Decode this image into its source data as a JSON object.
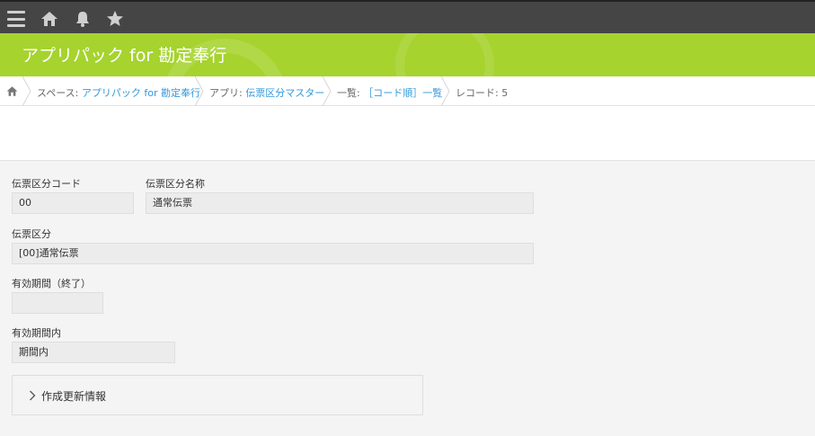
{
  "header": {
    "app_title": "アプリパック for 勘定奉行",
    "accent_color": "#a6d32e",
    "topbar_color": "#454545",
    "icons": [
      "menu-icon",
      "home-icon",
      "bell-icon",
      "star-icon"
    ]
  },
  "breadcrumb": {
    "space_prefix": "スペース: ",
    "space_link": "アプリパック for 勘定奉行",
    "app_prefix": "アプリ: ",
    "app_link": "伝票区分マスター",
    "list_prefix": "一覧: ",
    "list_link": "［コード順］一覧",
    "record": "レコード: 5"
  },
  "form": {
    "code_label": "伝票区分コード",
    "code_value": "00",
    "name_label": "伝票区分名称",
    "name_value": "通常伝票",
    "kubun_label": "伝票区分",
    "kubun_value": "[00]通常伝票",
    "end_label": "有効期間（終了）",
    "end_value": "",
    "within_label": "有効期間内",
    "within_value": "期間内",
    "section_label": "作成更新情報"
  }
}
